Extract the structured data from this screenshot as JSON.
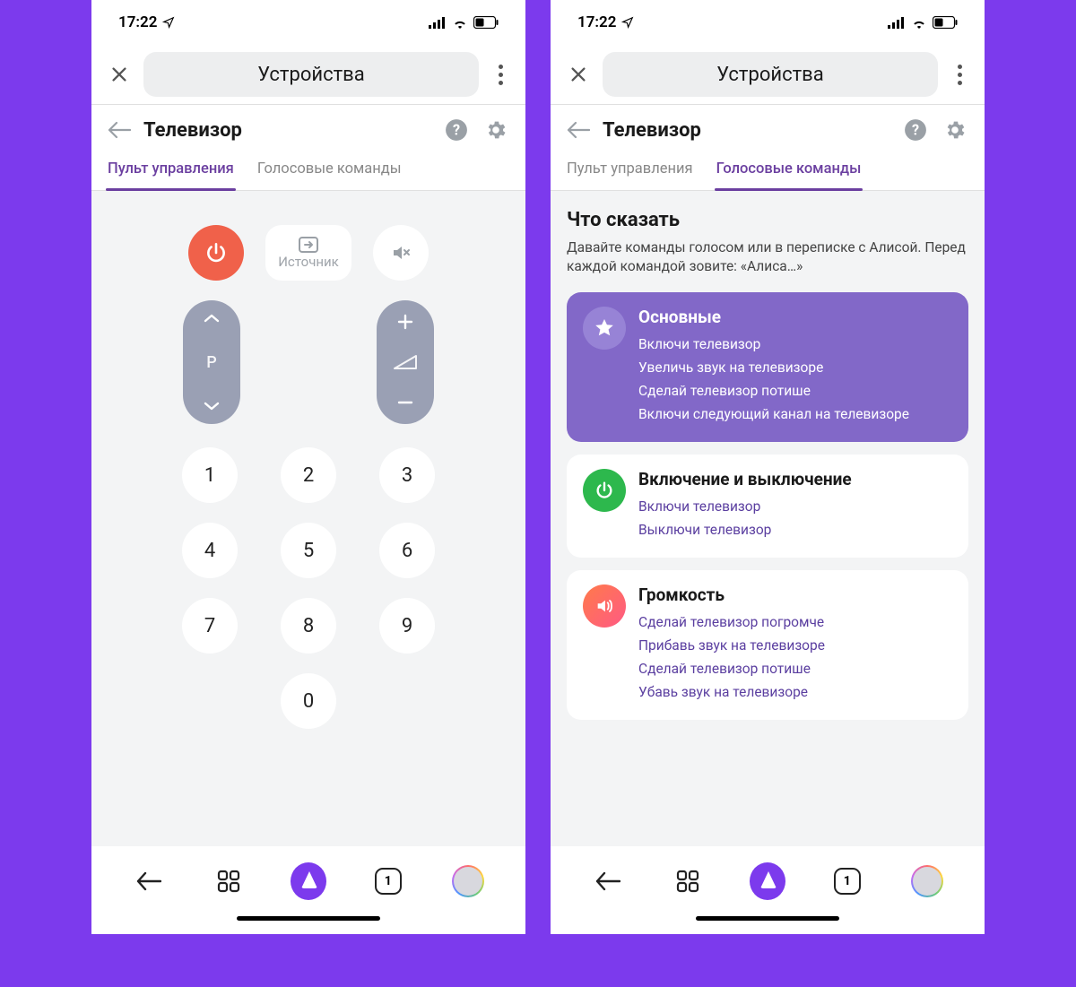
{
  "status": {
    "time": "17:22"
  },
  "topbar": {
    "label": "Устройства"
  },
  "sub": {
    "title": "Телевизор"
  },
  "tabs": {
    "remote": "Пульт управления",
    "voice": "Голосовые команды"
  },
  "remote": {
    "source_label": "Источник",
    "channel_mid": "P",
    "keys": [
      "1",
      "2",
      "3",
      "4",
      "5",
      "6",
      "7",
      "8",
      "9",
      "0"
    ]
  },
  "voice": {
    "heading": "Что сказать",
    "subtitle": "Давайте команды голосом или в переписке с Алисой. Перед каждой командой зовите: «Алиса…»",
    "group_main": {
      "title": "Основные",
      "items": [
        "Включи телевизор",
        "Увеличь звук на телевизоре",
        "Сделай телевизор потише",
        "Включи следующий канал на телевизоре"
      ]
    },
    "group_power": {
      "title": "Включение и выключение",
      "items": [
        "Включи телевизор",
        "Выключи телевизор"
      ]
    },
    "group_volume": {
      "title": "Громкость",
      "items": [
        "Сделай телевизор погромче",
        "Прибавь звук на телевизоре",
        "Сделай телевизор потише",
        "Убавь звук на телевизоре"
      ]
    }
  },
  "bottom": {
    "tab_count": "1"
  }
}
